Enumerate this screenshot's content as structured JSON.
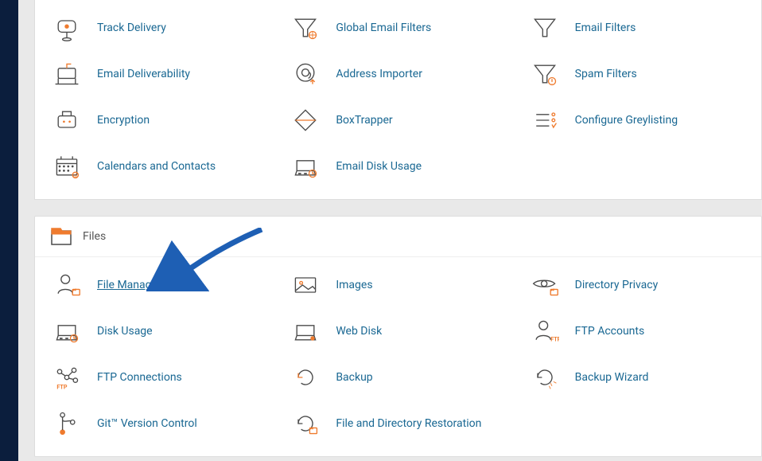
{
  "sections": {
    "email": {
      "items": [
        {
          "label": "Track Delivery"
        },
        {
          "label": "Global Email Filters"
        },
        {
          "label": "Email Filters"
        },
        {
          "label": "Email Deliverability"
        },
        {
          "label": "Address Importer"
        },
        {
          "label": "Spam Filters"
        },
        {
          "label": "Encryption"
        },
        {
          "label": "BoxTrapper"
        },
        {
          "label": "Configure Greylisting"
        },
        {
          "label": "Calendars and Contacts"
        },
        {
          "label": "Email Disk Usage"
        }
      ]
    },
    "files": {
      "title": "Files",
      "items": [
        {
          "label": "File Manager"
        },
        {
          "label": "Images"
        },
        {
          "label": "Directory Privacy"
        },
        {
          "label": "Disk Usage"
        },
        {
          "label": "Web Disk"
        },
        {
          "label": "FTP Accounts"
        },
        {
          "label": "FTP Connections"
        },
        {
          "label": "Backup"
        },
        {
          "label": "Backup Wizard"
        },
        {
          "label": "Git™ Version Control"
        },
        {
          "label": "File and Directory Restoration"
        }
      ]
    }
  }
}
